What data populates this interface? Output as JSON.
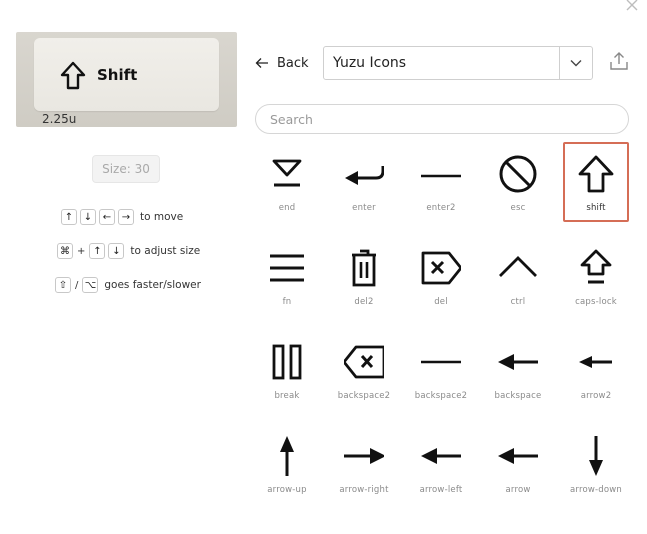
{
  "preview": {
    "key_label": "Shift",
    "key_size": "2.25u",
    "size_display": "Size: 30"
  },
  "hints": {
    "move": "to move",
    "adjust": "to adjust size",
    "speed": "goes faster/slower",
    "plus": "+",
    "slash": "/"
  },
  "toolbar": {
    "back_label": "Back",
    "icon_set": "Yuzu Icons"
  },
  "search": {
    "placeholder": "Search",
    "value": ""
  },
  "colors": {
    "selected_border": "#d56d56"
  },
  "icons": [
    {
      "label": "end",
      "icon": "end-icon"
    },
    {
      "label": "enter",
      "icon": "enter-icon"
    },
    {
      "label": "enter2",
      "icon": "enter2-icon"
    },
    {
      "label": "esc",
      "icon": "esc-icon"
    },
    {
      "label": "shift",
      "icon": "shift-icon",
      "selected": true
    },
    {
      "label": "fn",
      "icon": "fn-icon"
    },
    {
      "label": "del2",
      "icon": "del2-icon"
    },
    {
      "label": "del",
      "icon": "del-icon"
    },
    {
      "label": "ctrl",
      "icon": "ctrl-icon"
    },
    {
      "label": "caps-lock",
      "icon": "caps-lock-icon"
    },
    {
      "label": "break",
      "icon": "break-icon"
    },
    {
      "label": "backspace2",
      "icon": "backspace2-icon"
    },
    {
      "label": "backspace2",
      "icon": "backspace2-long-icon"
    },
    {
      "label": "backspace",
      "icon": "backspace-icon"
    },
    {
      "label": "arrow2",
      "icon": "arrow2-icon"
    },
    {
      "label": "arrow-up",
      "icon": "arrow-up-icon"
    },
    {
      "label": "arrow-right",
      "icon": "arrow-right-icon"
    },
    {
      "label": "arrow-left",
      "icon": "arrow-left-icon"
    },
    {
      "label": "arrow",
      "icon": "arrow-icon"
    },
    {
      "label": "arrow-down",
      "icon": "arrow-down-icon"
    }
  ]
}
